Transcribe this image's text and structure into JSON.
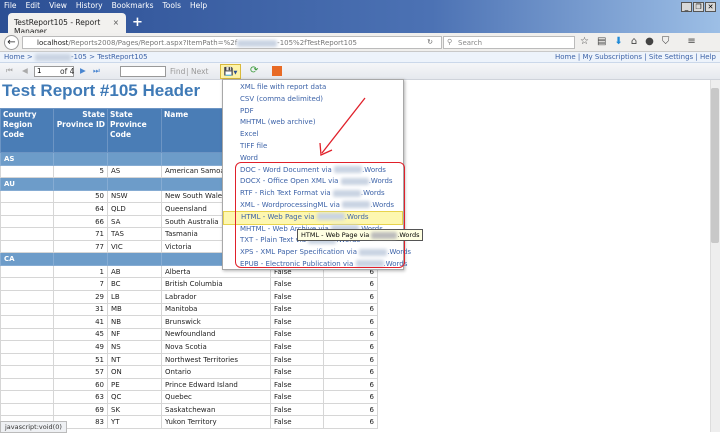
{
  "browser": {
    "menu": [
      "File",
      "Edit",
      "View",
      "History",
      "Bookmarks",
      "Tools",
      "Help"
    ],
    "tab_title": "TestReport105 - Report Manager",
    "tab_close": "×",
    "new_tab": "+",
    "url_host": "localhost",
    "url_path": "/Reports2008/Pages/Report.aspx?ItemPath=%2f",
    "url_tail": "-105%2fTestReport105",
    "search_placeholder": "Search",
    "status": "javascript:void(0)"
  },
  "breadcrumb": {
    "home": "Home",
    "sep": " > ",
    "middle_suffix": "-105",
    "current": "TestReport105"
  },
  "top_links": [
    "Home",
    "My Subscriptions",
    "Site Settings",
    "Help"
  ],
  "toolbar": {
    "page": "1",
    "of": "of 4",
    "find": "Find",
    "next": "Next",
    "sep": "|"
  },
  "report": {
    "title": "Test Report #105 Header",
    "columns": [
      "Country Region Code",
      "State Province ID",
      "State Province Code",
      "Name"
    ],
    "groups": [
      {
        "code": "AS",
        "rows": [
          [
            "5",
            "AS",
            "American Samoa",
            "",
            ""
          ]
        ]
      },
      {
        "code": "AU",
        "rows": [
          [
            "50",
            "NSW",
            "New South Wales",
            "",
            ""
          ],
          [
            "64",
            "QLD",
            "Queensland",
            "",
            ""
          ],
          [
            "66",
            "SA",
            "South Australia",
            "",
            ""
          ],
          [
            "71",
            "TAS",
            "Tasmania",
            "",
            ""
          ],
          [
            "77",
            "VIC",
            "Victoria",
            "",
            ""
          ]
        ]
      },
      {
        "code": "CA",
        "rows": [
          [
            "1",
            "AB",
            "Alberta",
            "False",
            "6"
          ],
          [
            "7",
            "BC",
            "British Columbia",
            "False",
            "6"
          ],
          [
            "29",
            "LB",
            "Labrador",
            "False",
            "6"
          ],
          [
            "31",
            "MB",
            "Manitoba",
            "False",
            "6"
          ],
          [
            "41",
            "NB",
            "Brunswick",
            "False",
            "6"
          ],
          [
            "45",
            "NF",
            "Newfoundland",
            "False",
            "6"
          ],
          [
            "49",
            "NS",
            "Nova Scotia",
            "False",
            "6"
          ],
          [
            "51",
            "NT",
            "Northwest Territories",
            "False",
            "6"
          ],
          [
            "57",
            "ON",
            "Ontario",
            "False",
            "6"
          ],
          [
            "60",
            "PE",
            "Prince Edward Island",
            "False",
            "6"
          ],
          [
            "63",
            "QC",
            "Quebec",
            "False",
            "6"
          ],
          [
            "69",
            "SK",
            "Saskatchewan",
            "False",
            "6"
          ],
          [
            "83",
            "YT",
            "Yukon Territory",
            "False",
            "6"
          ]
        ]
      }
    ]
  },
  "export_menu": {
    "items": [
      "XML file with report data",
      "CSV (comma delimited)",
      "PDF",
      "MHTML (web archive)",
      "Excel",
      "TIFF file",
      "Word"
    ],
    "custom_items": [
      {
        "prefix": "DOC - Word Document via ",
        "suffix": ".Words"
      },
      {
        "prefix": "DOCX - Office Open XML via ",
        "suffix": ".Words"
      },
      {
        "prefix": "RTF - Rich Text Format via ",
        "suffix": ".Words"
      },
      {
        "prefix": "XML - WordprocessingML via ",
        "suffix": ".Words"
      },
      {
        "prefix": "HTML - Web Page via ",
        "suffix": ".Words"
      },
      {
        "prefix": "MHTML - Web Archive via ",
        "suffix": ".Words"
      },
      {
        "prefix": "TXT - Plain Text via ",
        "suffix": ".Words"
      },
      {
        "prefix": "XPS - XML Paper Specification via ",
        "suffix": ".Words"
      },
      {
        "prefix": "EPUB - Electronic Publication via ",
        "suffix": ".Words"
      }
    ],
    "highlighted_index": 4,
    "tooltip": {
      "prefix": "HTML - Web Page via ",
      "suffix": ".Words"
    }
  },
  "colors": {
    "accent": "#3f7ab6",
    "header": "#4a7db6",
    "group": "#6d9cc9",
    "annotation": "#e0202a"
  }
}
